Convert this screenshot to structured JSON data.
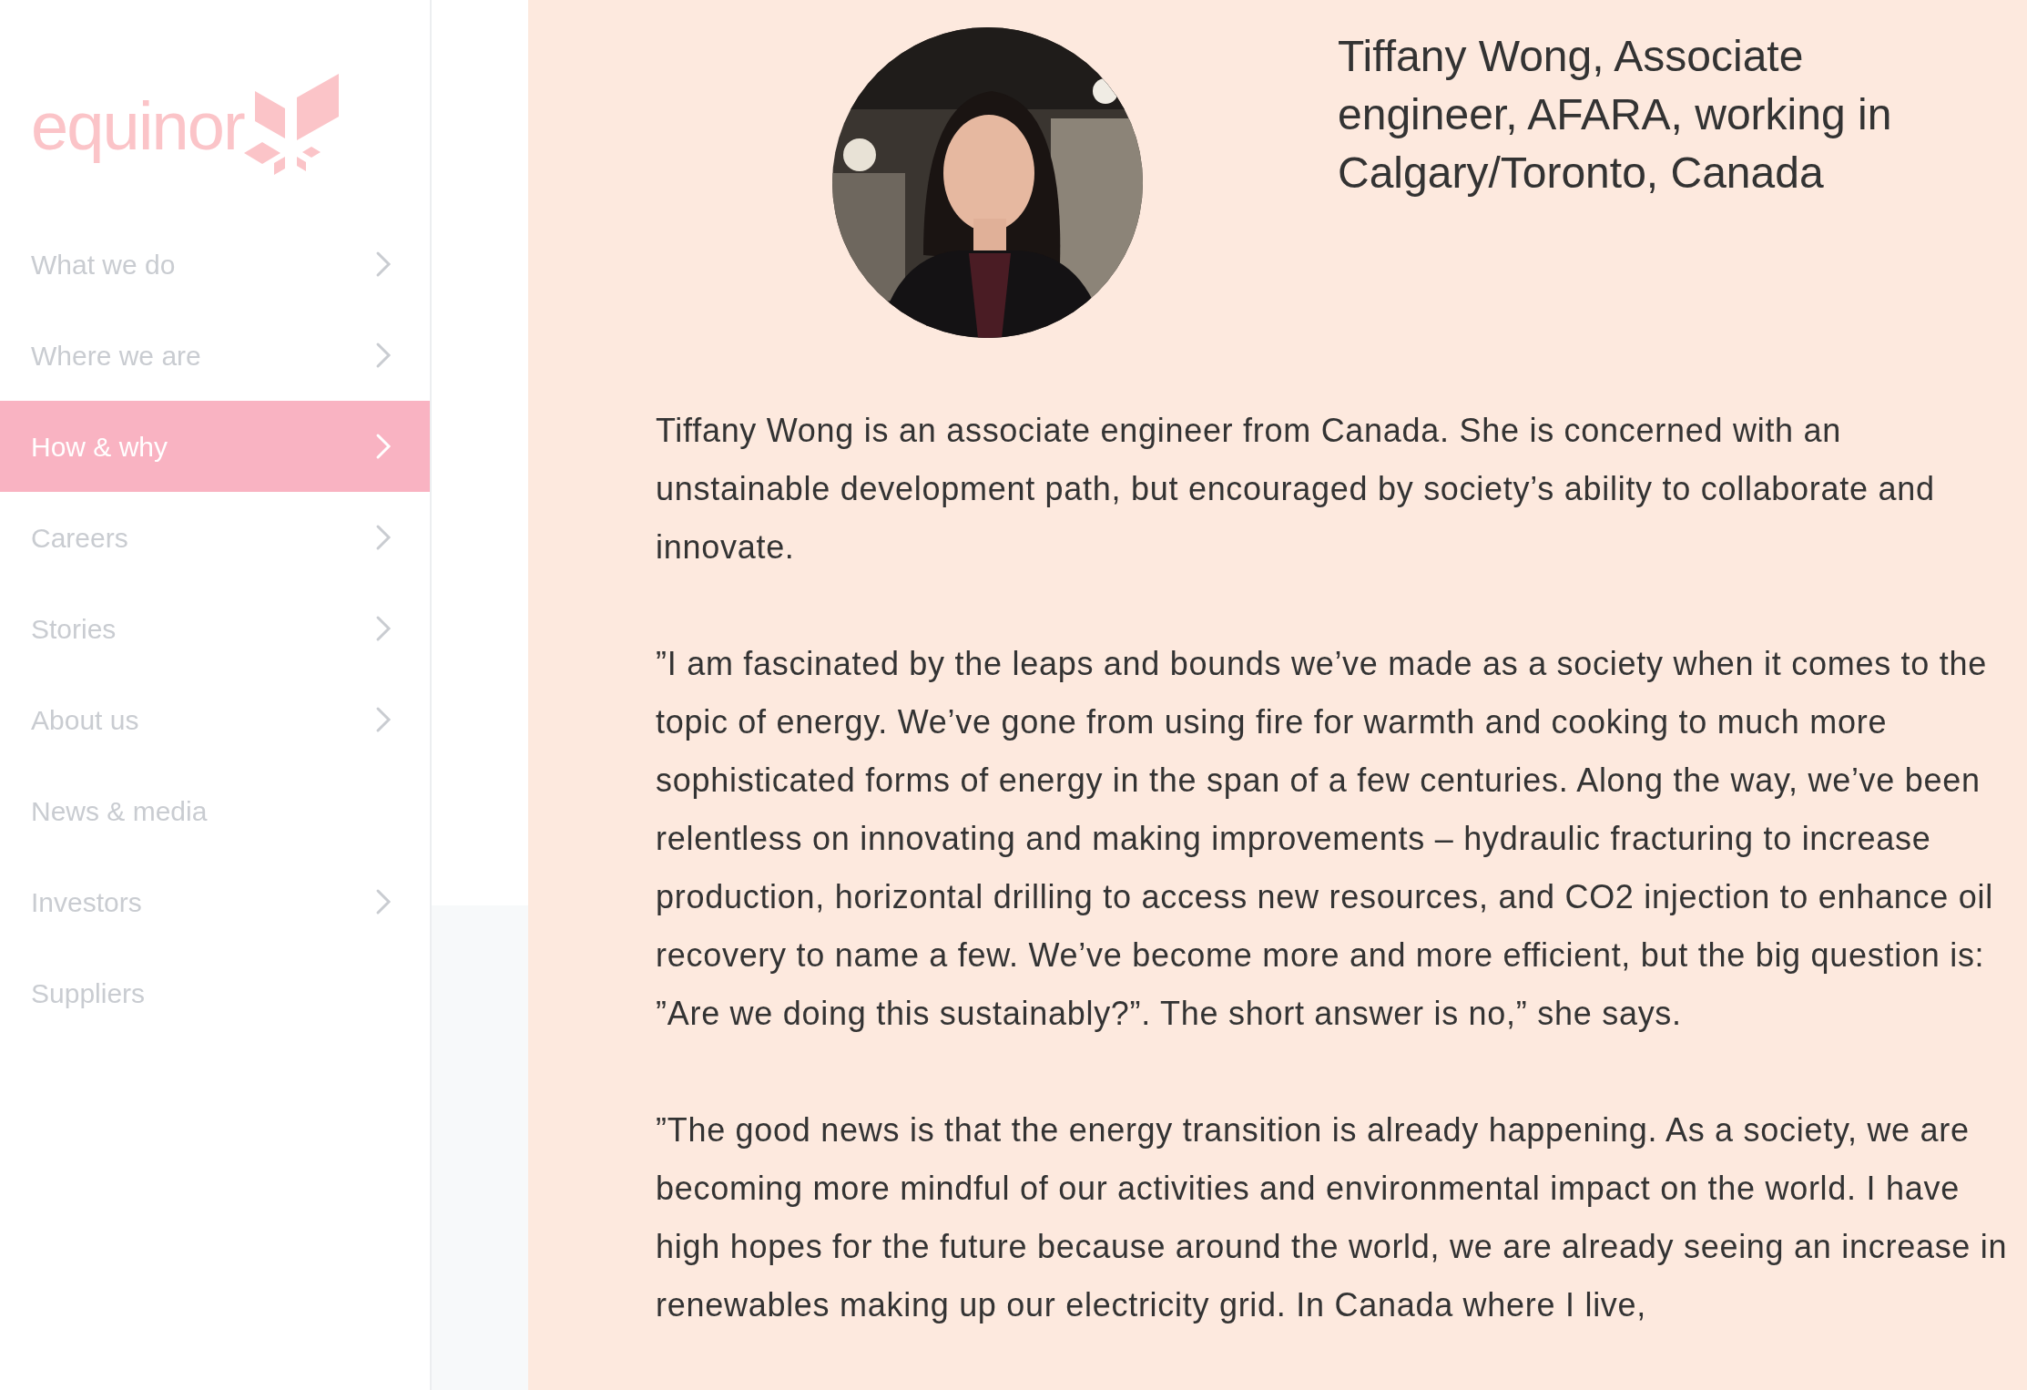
{
  "logo": {
    "text": "equinor"
  },
  "nav": [
    {
      "label": "What we do",
      "selected": false,
      "has_submenu": true
    },
    {
      "label": "Where we are",
      "selected": false,
      "has_submenu": true
    },
    {
      "label": "How & why",
      "selected": true,
      "has_submenu": true
    },
    {
      "label": "Careers",
      "selected": false,
      "has_submenu": true
    },
    {
      "label": "Stories",
      "selected": false,
      "has_submenu": true
    },
    {
      "label": "About us",
      "selected": false,
      "has_submenu": true
    },
    {
      "label": "News & media",
      "selected": false,
      "has_submenu": false
    },
    {
      "label": "Investors",
      "selected": false,
      "has_submenu": true
    },
    {
      "label": "Suppliers",
      "selected": false,
      "has_submenu": false
    }
  ],
  "profile": {
    "caption": "Tiffany Wong, Associate engineer, AFARA, working in Calgary/Toronto, Canada"
  },
  "paragraphs": [
    "Tiffany Wong is an associate engineer from Canada. She is concerned with an unstainable development path, but encouraged by society’s ability to collaborate and innovate.",
    "”I am fascinated by the leaps and bounds we’ve made as a society when it comes to the topic of energy. We’ve gone from using fire for warmth and cooking to much more sophisticated forms of energy in the span of a few centuries. Along the way, we’ve been relentless on innovating and making improvements – hydraulic fracturing to increase production, horizontal drilling to access new resources, and CO2 injection to enhance oil recovery to name a few. We’ve become more and more efficient, but the big question is: ”Are we doing this sustainably?”. The short answer is no,” she says.",
    "”The good news is that the energy transition is already happening. As a society, we are becoming more mindful of our activities and environmental impact on the world. I have high hopes for the future because around the world, we are already seeing an increase in renewables making up our electricity grid. In Canada where I live,"
  ]
}
